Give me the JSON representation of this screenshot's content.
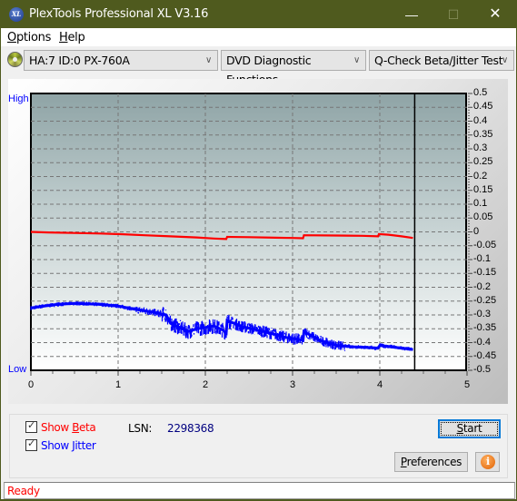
{
  "window": {
    "title": "PlexTools Professional XL V3.16",
    "icon_label": "XL",
    "controls": {
      "minimize": "—",
      "maximize": "☐",
      "close": "✕"
    }
  },
  "menu": {
    "items": [
      {
        "label": "Options",
        "accel": "O",
        "rest": "ptions"
      },
      {
        "label": "Help",
        "accel": "H",
        "rest": "elp"
      }
    ]
  },
  "toolbar": {
    "drive_select": "HA:7 ID:0  PX-760A",
    "function_select": "DVD Diagnostic Functions",
    "test_select": "Q-Check Beta/Jitter Test"
  },
  "chart_labels": {
    "high": "High",
    "low": "Low"
  },
  "chart_data": {
    "type": "line",
    "title": "",
    "xlabel": "",
    "ylabel": "",
    "xlim": [
      0,
      5
    ],
    "ylim": [
      -0.5,
      0.5
    ],
    "x_ticks": [
      "0",
      "1",
      "2",
      "3",
      "4",
      "5"
    ],
    "y_ticks": [
      "0.5",
      "0.45",
      "0.4",
      "0.35",
      "0.3",
      "0.25",
      "0.2",
      "0.15",
      "0.1",
      "0.05",
      "0",
      "-0.05",
      "-0.1",
      "-0.15",
      "-0.2",
      "-0.25",
      "-0.3",
      "-0.35",
      "-0.4",
      "-0.45",
      "-0.5"
    ],
    "grid": true,
    "cursor_x": 4.4,
    "colors": {
      "beta": "#ff0000",
      "jitter": "#0000ff"
    },
    "series": [
      {
        "name": "Beta",
        "x": [
          0,
          0.2,
          0.5,
          0.8,
          1.0,
          1.3,
          1.6,
          1.9,
          2.1,
          2.24,
          2.25,
          2.5,
          2.8,
          3.0,
          3.12,
          3.13,
          3.5,
          3.8,
          3.98,
          3.99,
          4.1,
          4.25,
          4.38
        ],
        "values": [
          0.0,
          -0.002,
          -0.004,
          -0.006,
          -0.008,
          -0.012,
          -0.016,
          -0.02,
          -0.024,
          -0.026,
          -0.018,
          -0.019,
          -0.021,
          -0.022,
          -0.023,
          -0.012,
          -0.013,
          -0.014,
          -0.016,
          -0.008,
          -0.01,
          -0.016,
          -0.022
        ]
      },
      {
        "name": "Jitter",
        "x": [
          0,
          0.1,
          0.3,
          0.5,
          0.8,
          1.0,
          1.2,
          1.4,
          1.55,
          1.6,
          1.7,
          1.8,
          1.9,
          2.0,
          2.1,
          2.2,
          2.24,
          2.25,
          2.4,
          2.6,
          2.8,
          2.9,
          3.0,
          3.1,
          3.12,
          3.13,
          3.3,
          3.5,
          3.7,
          3.9,
          3.98,
          4.0,
          4.2,
          4.38
        ],
        "values": [
          -0.275,
          -0.27,
          -0.262,
          -0.258,
          -0.262,
          -0.268,
          -0.28,
          -0.29,
          -0.3,
          -0.33,
          -0.345,
          -0.36,
          -0.35,
          -0.345,
          -0.34,
          -0.355,
          -0.365,
          -0.32,
          -0.34,
          -0.355,
          -0.37,
          -0.38,
          -0.385,
          -0.39,
          -0.392,
          -0.36,
          -0.39,
          -0.41,
          -0.415,
          -0.418,
          -0.42,
          -0.41,
          -0.418,
          -0.425
        ]
      }
    ]
  },
  "options": {
    "show_beta": {
      "label": "Show Beta",
      "prefix": "Show ",
      "accel": "B",
      "rest": "eta",
      "checked": true,
      "color": "#ff0000"
    },
    "show_jitter": {
      "label": "Show Jitter",
      "prefix": "Show ",
      "accel": "J",
      "rest": "itter",
      "checked": true,
      "color": "#0000ff"
    }
  },
  "lsn": {
    "label": "LSN:",
    "value": "2298368"
  },
  "buttons": {
    "start": {
      "label": "Start",
      "accel": "S",
      "rest": "tart"
    },
    "preferences": {
      "label": "Preferences",
      "accel": "P",
      "rest": "references"
    },
    "info": "i"
  },
  "status": {
    "text": "Ready"
  }
}
